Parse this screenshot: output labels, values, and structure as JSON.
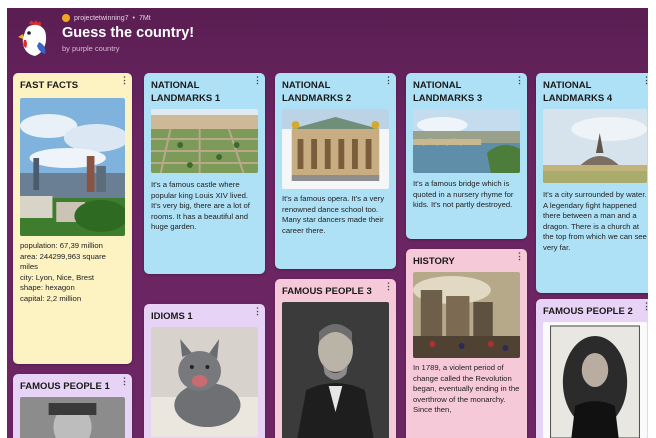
{
  "header": {
    "author": "projectetwinning7",
    "separator": "•",
    "time": "7Mt",
    "title": "Guess the country!",
    "subtitle": "by purple country"
  },
  "cards": {
    "fast_facts": {
      "title": "FAST FACTS",
      "lines": [
        "population: 67,39 million",
        "area: 244299,963 square miles",
        "city: Lyon, Nice, Brest",
        "shape: hexagon",
        "capital: 2,2 million"
      ]
    },
    "famous_people_1": {
      "title": "FAMOUS PEOPLE 1"
    },
    "landmarks_1": {
      "title": "NATIONAL LANDMARKS 1",
      "text": "It's a famous castle where popular king Louis XIV lived. It's very big, there are a lot of rooms. It has a beautiful and huge garden."
    },
    "idioms_1": {
      "title": "IDIOMS 1"
    },
    "landmarks_2": {
      "title": "NATIONAL LANDMARKS 2",
      "text": "It's a famous opera. It's a very renowned dance school too. Many star dancers made their career there."
    },
    "famous_people_3": {
      "title": "FAMOUS PEOPLE 3"
    },
    "landmarks_3": {
      "title": "NATIONAL LANDMARKS 3",
      "text": "It's a famous bridge which is quoted in a nursery rhyme for kids. It's not partly destroyed."
    },
    "history": {
      "title": "HISTORY",
      "text": "In 1789, a violent period of change called the Revolution began, eventually ending in the overthrow of the monarchy. Since then,"
    },
    "landmarks_4": {
      "title": "NATIONAL LANDMARKS 4",
      "text": "It's a city surrounded by water. A legendary fight happened there between a man and a dragon. There is a church at the top from which we can see very far."
    },
    "famous_people_2": {
      "title": "FAMOUS PEOPLE 2"
    }
  },
  "menu_glyph": "⋮",
  "colors": {
    "background": "#6a2461",
    "yellow_card": "#fdf2c2",
    "blue_card": "#aee1f6",
    "purple_card": "#e6d3f5",
    "pink_card": "#f6c9d8"
  }
}
